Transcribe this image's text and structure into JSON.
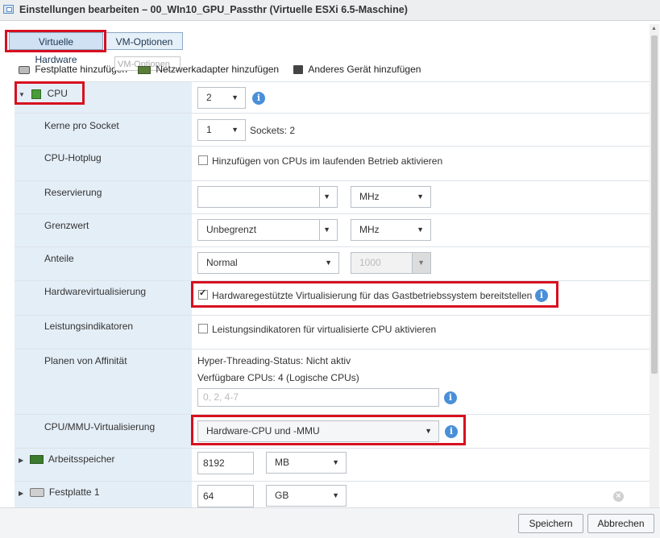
{
  "window": {
    "title": "Einstellungen bearbeiten – 00_WIn10_GPU_Passthr (Virtuelle ESXi 6.5-Maschine)"
  },
  "tabs": [
    {
      "label": "Virtuelle Hardware",
      "active": true
    },
    {
      "label": "VM-Optionen",
      "active": false
    }
  ],
  "tooltip": "VM-Optionen",
  "toolbar": {
    "add_disk": "Festplatte hinzufügen",
    "add_nic": "Netzwerkadapter hinzufügen",
    "add_device": "Anderes Gerät hinzufügen"
  },
  "cpu": {
    "label": "CPU",
    "count": "2",
    "cores_label": "Kerne pro Socket",
    "cores_value": "1",
    "sockets_text": "Sockets: 2",
    "hotplug_label": "CPU-Hotplug",
    "hotplug_text": "Hinzufügen von CPUs im laufenden Betrieb aktivieren",
    "reservation_label": "Reservierung",
    "reservation_value": "",
    "reservation_unit": "MHz",
    "limit_label": "Grenzwert",
    "limit_value": "Unbegrenzt",
    "limit_unit": "MHz",
    "shares_label": "Anteile",
    "shares_value": "Normal",
    "shares_number": "1000",
    "hwvirt_label": "Hardwarevirtualisierung",
    "hwvirt_text": "Hardwaregestützte Virtualisierung für das Gastbetriebssystem bereitstellen",
    "perf_label": "Leistungsindikatoren",
    "perf_text": "Leistungsindikatoren für virtualisierte CPU aktivieren",
    "affinity_label": "Planen von Affinität",
    "ht_status": "Hyper-Threading-Status: Nicht aktiv",
    "available_cpus": "Verfügbare CPUs: 4 (Logische CPUs)",
    "affinity_placeholder": "0, 2, 4-7",
    "mmu_label": "CPU/MMU-Virtualisierung",
    "mmu_value": "Hardware-CPU und -MMU"
  },
  "memory": {
    "label": "Arbeitsspeicher",
    "value": "8192",
    "unit": "MB"
  },
  "disk1": {
    "label": "Festplatte 1",
    "value": "64",
    "unit": "GB"
  },
  "footer": {
    "save": "Speichern",
    "cancel": "Abbrechen"
  },
  "colors": {
    "highlight": "#d6101f",
    "info": "#4a90d9",
    "label_column": "#e4eef7"
  }
}
